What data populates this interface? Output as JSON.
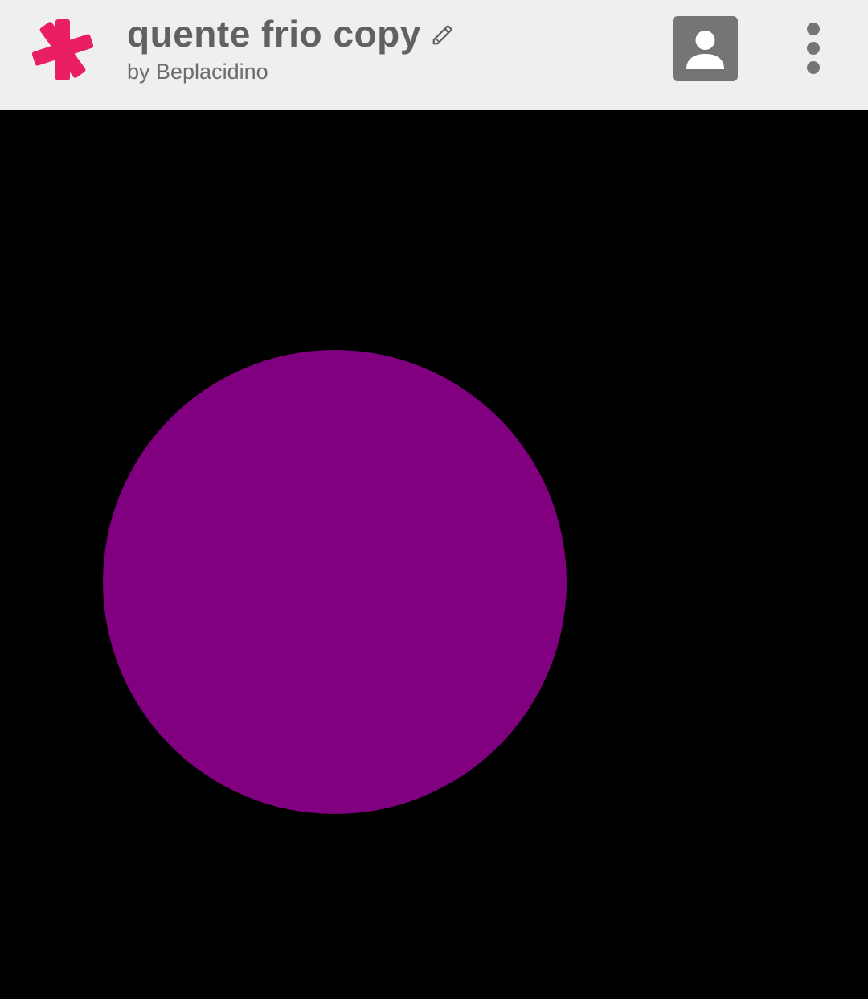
{
  "header": {
    "title": "quente frio copy",
    "subtitle": "by Beplacidino",
    "logo_icon": "asterisk-logo-icon",
    "edit_icon": "pencil-icon",
    "profile_icon": "account-box-icon",
    "menu_icon": "more-vertical-icon"
  },
  "colors": {
    "header_bg": "#efefef",
    "logo": "#e91e63",
    "title_text": "#616161",
    "profile_bg": "#757575",
    "canvas_bg": "#000000",
    "circle_fill": "#800080"
  }
}
